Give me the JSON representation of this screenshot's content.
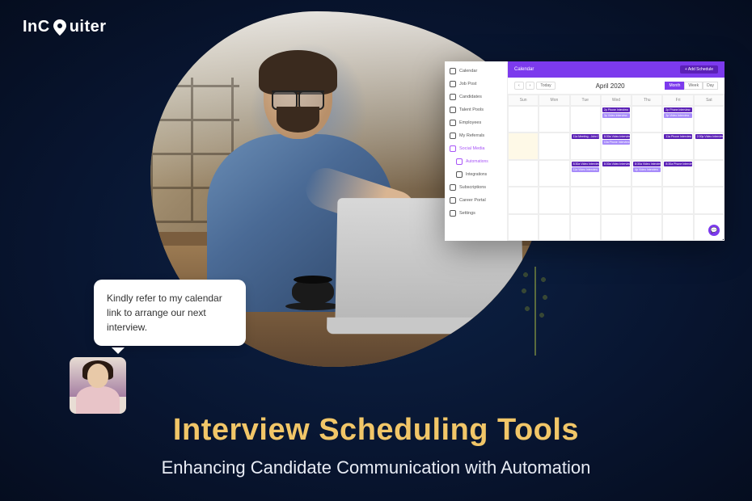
{
  "brand": {
    "name": "InCRuiter"
  },
  "speech_bubble": "Kindly refer to my calendar link to arrange our next interview.",
  "titles": {
    "main": "Interview Scheduling Tools",
    "sub": "Enhancing Candidate Communication with Automation"
  },
  "calendar": {
    "topbar_label": "Calendar",
    "add_button": "+ Add Schedule",
    "nav": {
      "prev": "‹",
      "next": "›",
      "today": "Today"
    },
    "month_title": "April 2020",
    "view_buttons": {
      "month": "Month",
      "week": "Week",
      "day": "Day"
    },
    "sidebar": [
      {
        "label": "Calendar",
        "icon": "calendar-icon"
      },
      {
        "label": "Job Post",
        "icon": "briefcase-icon"
      },
      {
        "label": "Candidates",
        "icon": "users-icon"
      },
      {
        "label": "Talent Pools",
        "icon": "database-icon"
      },
      {
        "label": "Employees",
        "icon": "id-icon"
      },
      {
        "label": "My Referrals",
        "icon": "share-icon"
      },
      {
        "label": "Social Media",
        "icon": "megaphone-icon",
        "active": true
      },
      {
        "label": "Automations",
        "icon": "bolt-icon",
        "sub": true,
        "active": true
      },
      {
        "label": "Integrations",
        "icon": "plug-icon",
        "sub": true
      },
      {
        "label": "Subscriptions",
        "icon": "card-icon"
      },
      {
        "label": "Career Portal",
        "icon": "globe-icon"
      },
      {
        "label": "Settings",
        "icon": "gear-icon"
      }
    ],
    "day_headers": [
      "Sun",
      "Mon",
      "Tue",
      "Wed",
      "Thu",
      "Fri",
      "Sat"
    ],
    "cells": [
      {},
      {},
      {},
      {
        "events": [
          "2p Phone Interview",
          "3p Video Interview"
        ]
      },
      {},
      {
        "events": [
          "2p Phone Interview",
          "3p Video Interview"
        ]
      },
      {},
      {
        "highlight": true
      },
      {},
      {
        "events": [
          "11a Meeting - John Do"
        ]
      },
      {
        "events": [
          "8:30a Video Interview",
          "10a Phone Interview"
        ]
      },
      {},
      {
        "events": [
          "11a Phone Interview"
        ]
      },
      {
        "events": [
          "2:30p Video Interview"
        ]
      },
      {},
      {},
      {
        "events": [
          "8:30a Video Interview",
          "11a Video Interview"
        ]
      },
      {
        "events": [
          "8:30a Video Interview"
        ]
      },
      {
        "events": [
          "8:30a Video Interview",
          "4p Video Interview"
        ]
      },
      {
        "events": [
          "8:30a Phone Interview"
        ]
      },
      {},
      {},
      {},
      {},
      {},
      {},
      {},
      {},
      {},
      {},
      {},
      {},
      {},
      {},
      {}
    ]
  }
}
